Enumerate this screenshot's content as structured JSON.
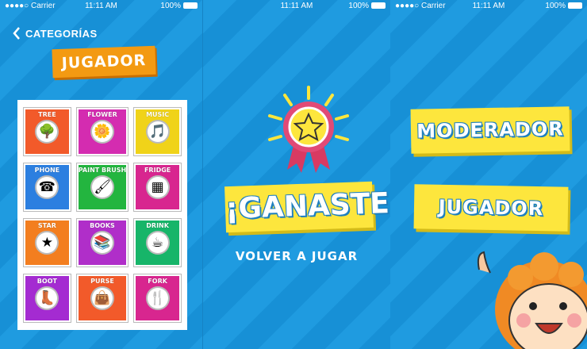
{
  "status": {
    "carrier": "Carrier",
    "time": "11:11 AM",
    "battery": "100%"
  },
  "screen1": {
    "back_label": "CATEGORÍAS",
    "mode_tag": "JUGADOR",
    "cards": [
      {
        "label": "TREE",
        "icon": "🌳",
        "color": "#f25a2a"
      },
      {
        "label": "FLOWER",
        "icon": "🌼",
        "color": "#d42cb0"
      },
      {
        "label": "MUSIC",
        "icon": "🎵",
        "color": "#f0d319"
      },
      {
        "label": "PHONE",
        "icon": "☎",
        "color": "#2c7fe0"
      },
      {
        "label": "PAINT BRUSH",
        "icon": "🖌",
        "color": "#23b53f"
      },
      {
        "label": "FRIDGE",
        "icon": "▦",
        "color": "#d8268f"
      },
      {
        "label": "STAR",
        "icon": "★",
        "color": "#f37e1f"
      },
      {
        "label": "BOOKS",
        "icon": "📚",
        "color": "#b02ec9"
      },
      {
        "label": "DRINK",
        "icon": "☕",
        "color": "#17b569"
      },
      {
        "label": "BOOT",
        "icon": "👢",
        "color": "#a42bd1"
      },
      {
        "label": "PURSE",
        "icon": "👜",
        "color": "#f25a2a"
      },
      {
        "label": "FORK",
        "icon": "🍴",
        "color": "#d8268f"
      }
    ]
  },
  "screen2": {
    "title": "¡GANASTE!",
    "replay_label": "VOLVER A JUGAR"
  },
  "screen3": {
    "moderator_label": "MODERADOR",
    "player_label": "JUGADOR"
  },
  "colors": {
    "bg": "#1f9be0",
    "yellow": "#fde63d",
    "orange": "#f39a12"
  }
}
